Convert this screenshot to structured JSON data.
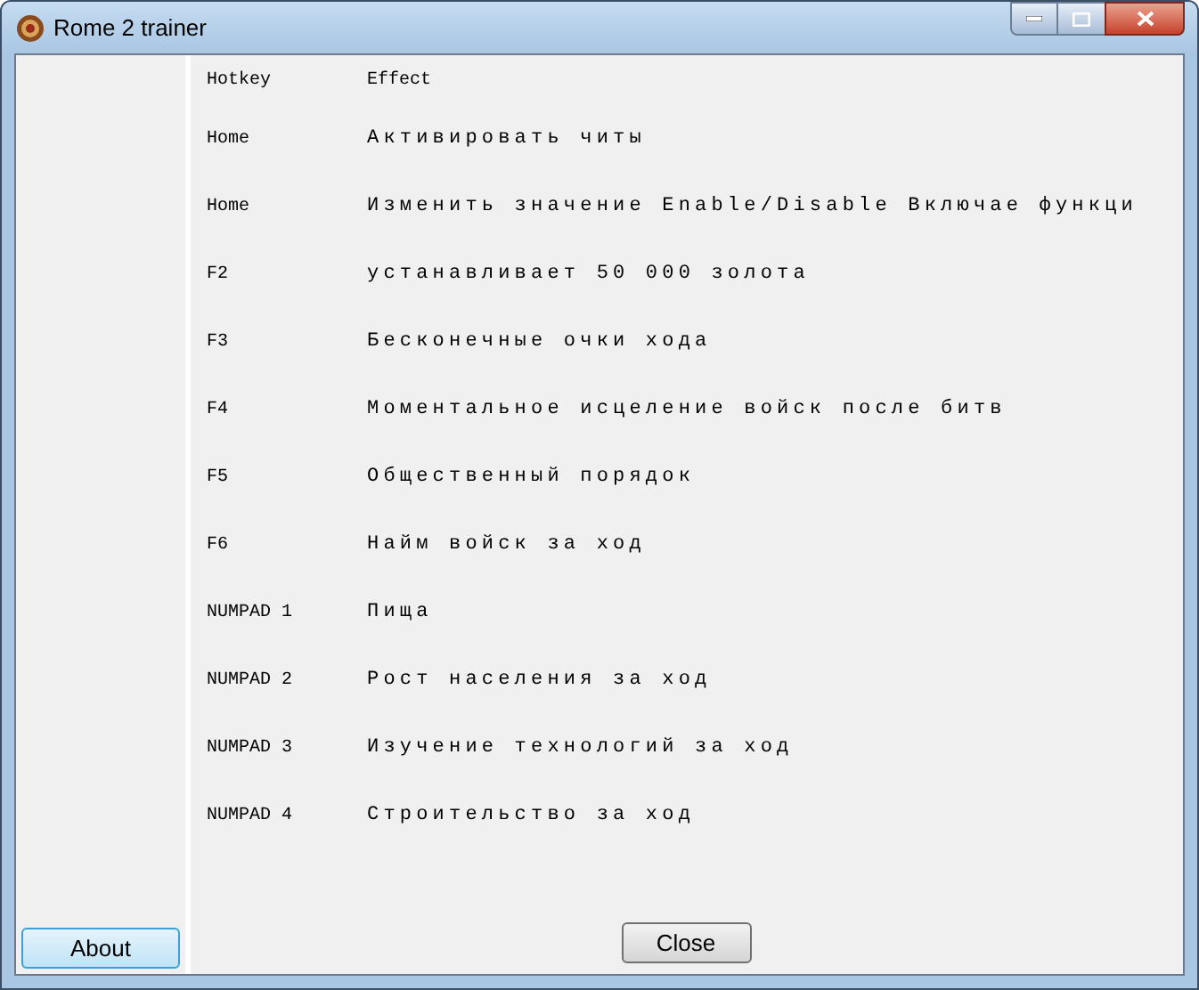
{
  "window": {
    "title": "Rome 2 trainer"
  },
  "table": {
    "columns": [
      "Hotkey",
      "Effect"
    ],
    "rows": [
      {
        "hotkey": "Home",
        "effect": "Активировать читы"
      },
      {
        "hotkey": "Home",
        "effect": "Изменить значение Enable/Disable Включае функци"
      },
      {
        "hotkey": "F2",
        "effect": "устанавливает 50 000 золота"
      },
      {
        "hotkey": "F3",
        "effect": "Бесконечные очки хода"
      },
      {
        "hotkey": "F4",
        "effect": "Моментальное исцеление войск после битв"
      },
      {
        "hotkey": "F5",
        "effect": "Общественный порядок"
      },
      {
        "hotkey": "F6",
        "effect": "Найм войск за ход"
      },
      {
        "hotkey": "NUMPAD 1",
        "effect": "Пища"
      },
      {
        "hotkey": "NUMPAD 2",
        "effect": "Рост населения за ход"
      },
      {
        "hotkey": "NUMPAD 3",
        "effect": "Изучение технологий за ход"
      },
      {
        "hotkey": "NUMPAD 4",
        "effect": "Строительство за ход"
      }
    ]
  },
  "about_button": "About",
  "close_button": "Close"
}
